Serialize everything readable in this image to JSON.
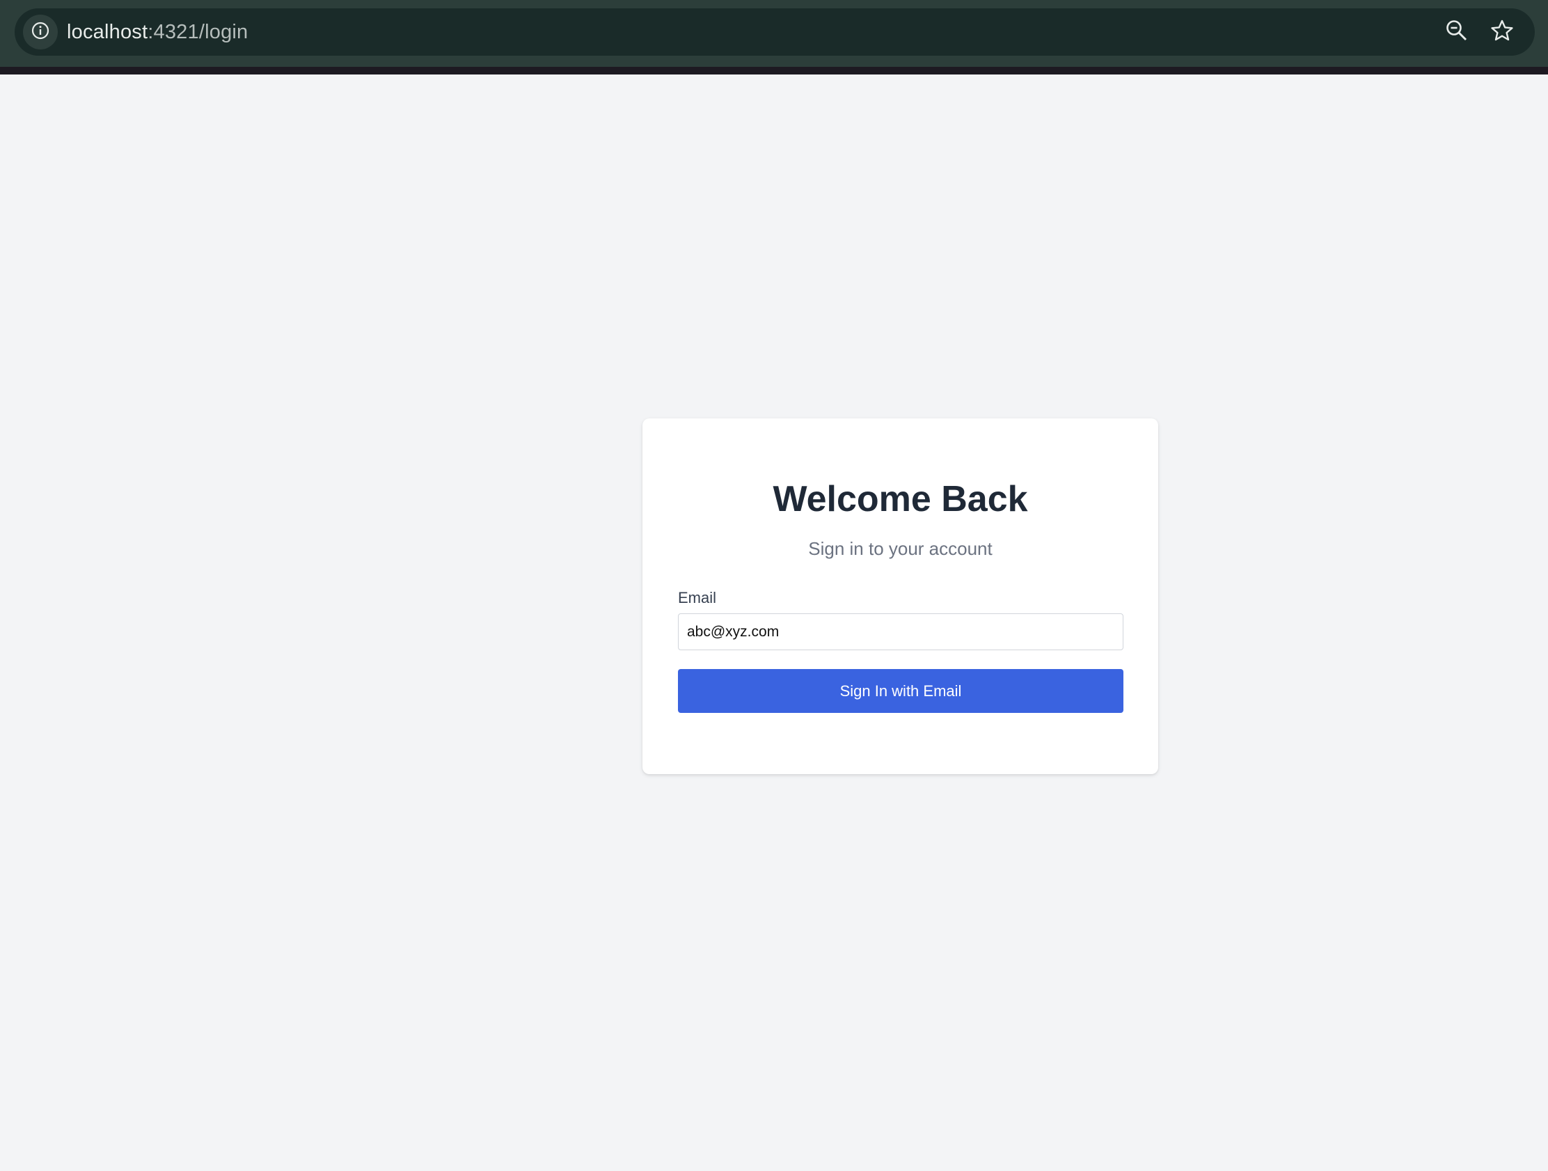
{
  "browser": {
    "url_host": "localhost",
    "url_rest": ":4321/login",
    "icons": {
      "site_info": "info-icon",
      "zoom": "zoom-out-icon",
      "bookmark": "star-icon"
    }
  },
  "login": {
    "title": "Welcome Back",
    "subtitle": "Sign in to your account",
    "email_label": "Email",
    "email_value": "abc@xyz.com",
    "submit_label": "Sign In with Email"
  },
  "colors": {
    "accent": "#3a63e0",
    "page_bg": "#f3f4f6",
    "chrome_bg": "#2c3e3a"
  }
}
